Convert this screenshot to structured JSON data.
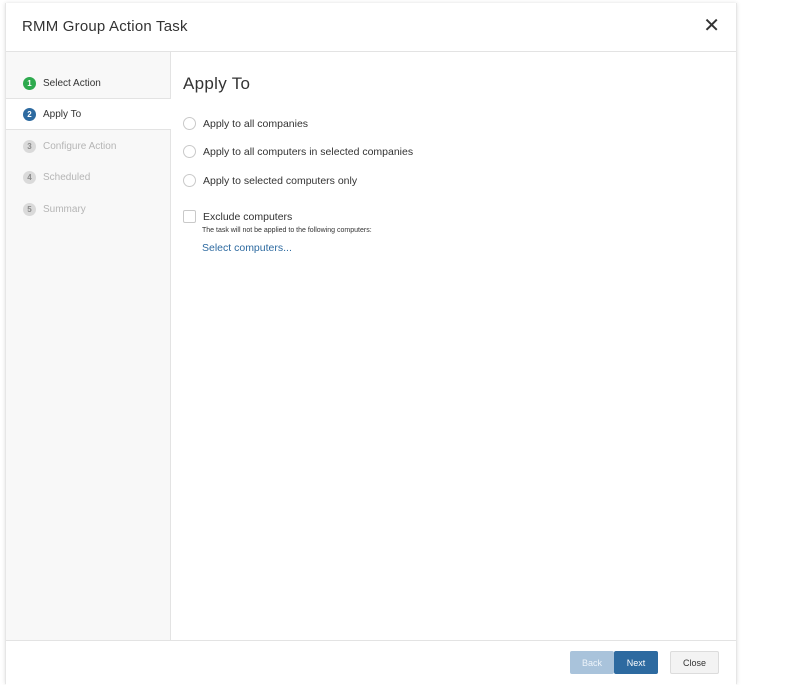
{
  "dialog": {
    "title": "RMM Group Action Task",
    "close_glyph": "✕"
  },
  "steps": [
    {
      "num": "1",
      "label": "Select Action",
      "state": "done"
    },
    {
      "num": "2",
      "label": "Apply To",
      "state": "current"
    },
    {
      "num": "3",
      "label": "Configure Action",
      "state": "pending"
    },
    {
      "num": "4",
      "label": "Scheduled",
      "state": "pending"
    },
    {
      "num": "5",
      "label": "Summary",
      "state": "pending"
    }
  ],
  "content": {
    "heading": "Apply To",
    "options": [
      "Apply to all companies",
      "Apply to all computers in selected companies",
      "Apply to selected computers only"
    ],
    "exclude_label": "Exclude computers",
    "exclude_note": "The task will not be applied to the following computers:",
    "select_link": "Select computers..."
  },
  "footer": {
    "back": "Back",
    "next": "Next",
    "close": "Close"
  },
  "colors": {
    "done": "#2eaa4e",
    "current": "#2d6aa0",
    "link": "#2d6aa0"
  }
}
